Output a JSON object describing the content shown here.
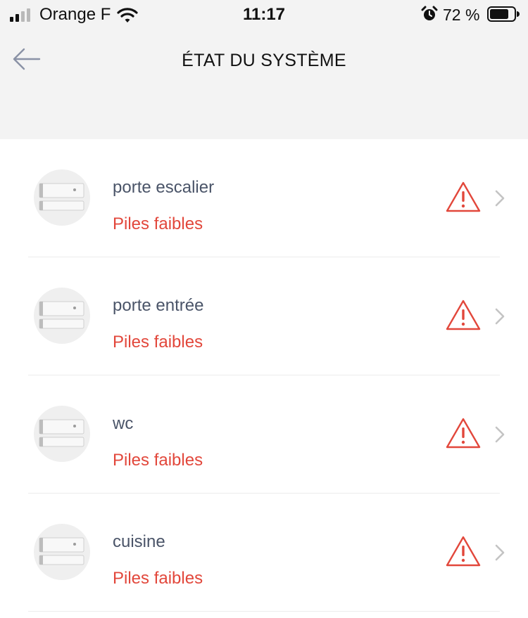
{
  "status_bar": {
    "carrier": "Orange F",
    "time": "11:17",
    "battery_percent": "72 %",
    "signal_bars_filled": 2,
    "signal_bars_total": 4,
    "icons": [
      "signal-icon",
      "wifi-icon",
      "alarm-clock-icon",
      "battery-icon"
    ]
  },
  "header": {
    "title": "ÉTAT DU SYSTÈME",
    "back_icon": "arrow-left-icon"
  },
  "devices": [
    {
      "name": "porte escalier",
      "status": "Piles faibles",
      "icon": "warning-triangle-icon"
    },
    {
      "name": "porte entrée",
      "status": "Piles faibles",
      "icon": "warning-triangle-icon"
    },
    {
      "name": "wc",
      "status": "Piles faibles",
      "icon": "warning-triangle-icon"
    },
    {
      "name": "cuisine",
      "status": "Piles faibles",
      "icon": "warning-triangle-icon"
    }
  ],
  "colors": {
    "header_bg": "#f3f3f3",
    "alert_red": "#e2473b",
    "device_name": "#4a5468",
    "chevron": "#c4c4c4"
  }
}
